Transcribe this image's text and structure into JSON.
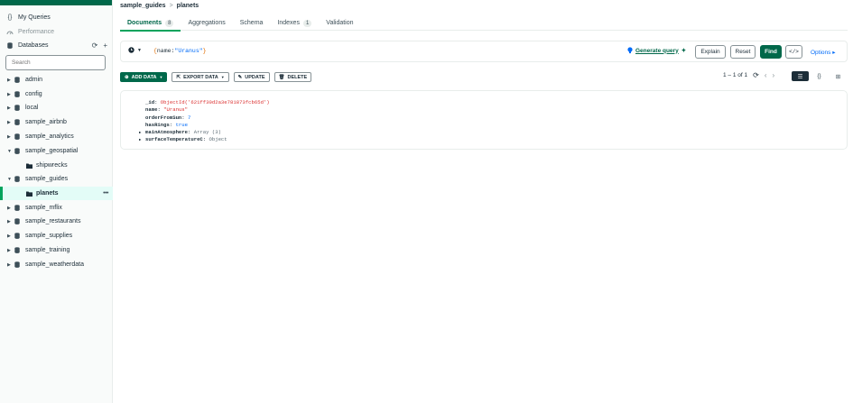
{
  "sidebar": {
    "my_queries": "My Queries",
    "performance": "Performance",
    "databases": "Databases",
    "search_placeholder": "Search",
    "databases_list": [
      {
        "name": "admin"
      },
      {
        "name": "config"
      },
      {
        "name": "local"
      },
      {
        "name": "sample_airbnb"
      },
      {
        "name": "sample_analytics"
      },
      {
        "name": "sample_geospatial"
      },
      {
        "name": "shipwrecks"
      },
      {
        "name": "sample_guides"
      },
      {
        "name": "planets"
      },
      {
        "name": "sample_mflix"
      },
      {
        "name": "sample_restaurants"
      },
      {
        "name": "sample_supplies"
      },
      {
        "name": "sample_training"
      },
      {
        "name": "sample_weatherdata"
      }
    ],
    "more_glyph": "•••"
  },
  "breadcrumb": {
    "db": "sample_guides",
    "sep": ">",
    "collection": "planets"
  },
  "tabs": [
    {
      "label": "Documents",
      "count": "8"
    },
    {
      "label": "Aggregations"
    },
    {
      "label": "Schema"
    },
    {
      "label": "Indexes",
      "count": "1"
    },
    {
      "label": "Validation"
    }
  ],
  "query": {
    "filter_open": "{",
    "filter_key": "name:",
    "filter_value": "\"Uranus\"",
    "filter_close": "}",
    "generate_label": "Generate query",
    "explain": "Explain",
    "reset": "Reset",
    "find": "Find",
    "code": "</>",
    "options": "Options ▸"
  },
  "actions": {
    "add_data": "ADD DATA",
    "export_data": "EXPORT DATA",
    "update": "UPDATE",
    "delete": "DELETE"
  },
  "pager": {
    "range": "1 – 1 of 1"
  },
  "document": {
    "id_key": "_id",
    "id_value": "ObjectId('621ff30d2a3e781873fcb65d')",
    "name_key": "name",
    "name_value": "\"Uranus\"",
    "order_key": "orderFromSun",
    "order_value": "7",
    "rings_key": "hasRings",
    "rings_value": "true",
    "atmos_key": "mainAtmosphere",
    "atmos_value": "Array (3)",
    "temp_key": "surfaceTemperatureC",
    "temp_value": "Object"
  },
  "colors": {
    "brand_green": "#00684a",
    "accent_green": "#00a35c",
    "link_blue": "#016bf8"
  }
}
